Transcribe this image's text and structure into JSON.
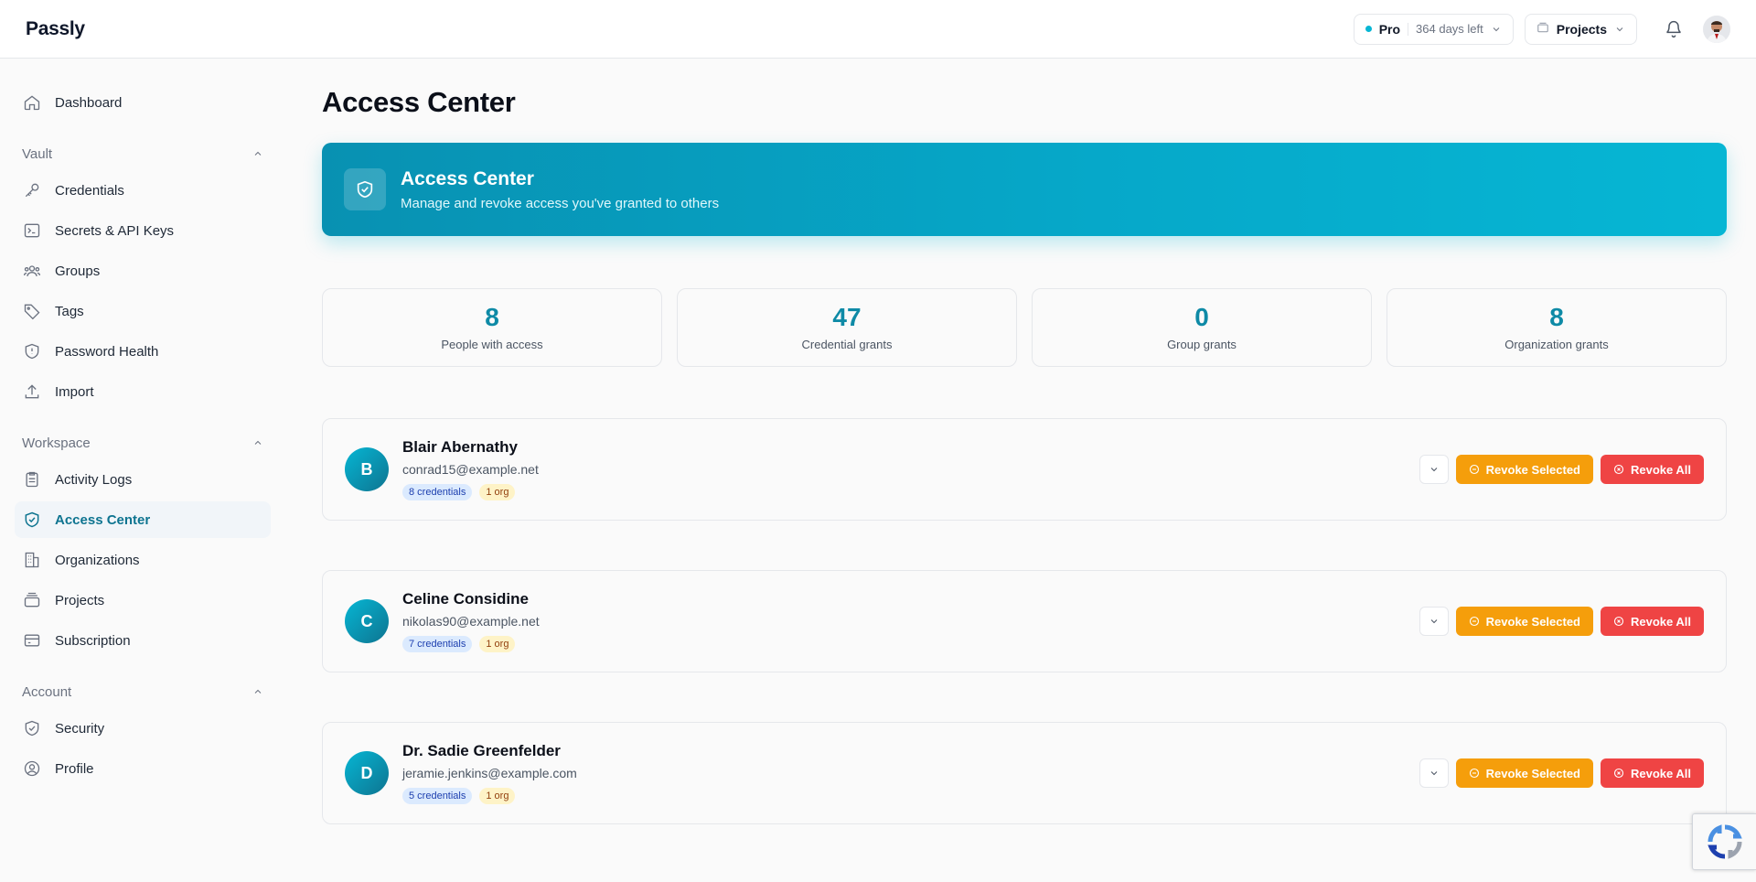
{
  "app": {
    "brand": "Passly"
  },
  "header": {
    "plan": "Pro",
    "days_left": "364 days left",
    "projects_label": "Projects"
  },
  "sidebar": {
    "top": [
      {
        "label": "Dashboard",
        "icon": "home-icon"
      }
    ],
    "sections": [
      {
        "title": "Vault",
        "items": [
          {
            "label": "Credentials",
            "icon": "key-icon"
          },
          {
            "label": "Secrets & API Keys",
            "icon": "terminal-icon"
          },
          {
            "label": "Groups",
            "icon": "users-icon"
          },
          {
            "label": "Tags",
            "icon": "tag-icon"
          },
          {
            "label": "Password Health",
            "icon": "shield-alert-icon"
          },
          {
            "label": "Import",
            "icon": "upload-icon"
          }
        ]
      },
      {
        "title": "Workspace",
        "items": [
          {
            "label": "Activity Logs",
            "icon": "clipboard-icon"
          },
          {
            "label": "Access Center",
            "icon": "shield-check-icon",
            "active": true
          },
          {
            "label": "Organizations",
            "icon": "building-icon"
          },
          {
            "label": "Projects",
            "icon": "folder-icon"
          },
          {
            "label": "Subscription",
            "icon": "credit-card-icon"
          }
        ]
      },
      {
        "title": "Account",
        "items": [
          {
            "label": "Security",
            "icon": "shield-check-icon"
          },
          {
            "label": "Profile",
            "icon": "user-circle-icon"
          }
        ]
      }
    ]
  },
  "main": {
    "title": "Access Center",
    "hero": {
      "title": "Access Center",
      "subtitle": "Manage and revoke access you've granted to others"
    },
    "stats": [
      {
        "value": "8",
        "label": "People with access"
      },
      {
        "value": "47",
        "label": "Credential grants"
      },
      {
        "value": "0",
        "label": "Group grants"
      },
      {
        "value": "8",
        "label": "Organization grants"
      }
    ],
    "people": [
      {
        "initial": "B",
        "name": "Blair Abernathy",
        "email": "conrad15@example.net",
        "credentials": "8 credentials",
        "orgs": "1 org"
      },
      {
        "initial": "C",
        "name": "Celine Considine",
        "email": "nikolas90@example.net",
        "credentials": "7 credentials",
        "orgs": "1 org"
      },
      {
        "initial": "D",
        "name": "Dr. Sadie Greenfelder",
        "email": "jeramie.jenkins@example.com",
        "credentials": "5 credentials",
        "orgs": "1 org"
      }
    ],
    "actions": {
      "revoke_selected": "Revoke Selected",
      "revoke_all": "Revoke All"
    }
  },
  "colors": {
    "accent": "#06b6d4",
    "accent_dark": "#0e7490",
    "warning": "#f59e0b",
    "danger": "#ef4444"
  }
}
